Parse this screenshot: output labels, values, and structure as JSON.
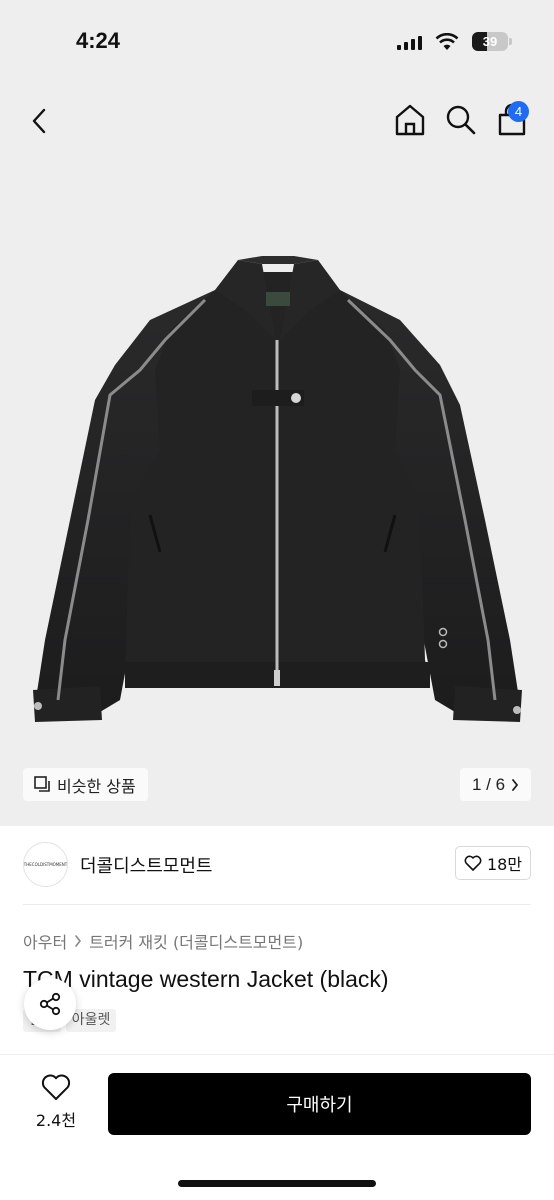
{
  "status_bar": {
    "time": "4:24",
    "battery": "39"
  },
  "nav": {
    "cart_count": "4",
    "icons": [
      "back-icon",
      "home-icon",
      "search-icon",
      "bag-icon"
    ]
  },
  "gallery": {
    "similar_label": "비슷한 상품",
    "counter": "1 / 6"
  },
  "shop": {
    "logo_text": "THECOLDISTMOMENT",
    "name": "더콜디스트모먼트",
    "likes": "18만"
  },
  "product": {
    "breadcrumb": [
      "아우터",
      "트러커 재킷 (더콜디스트모먼트)"
    ],
    "title": "TCM vintage western Jacket (black)",
    "tags": [
      "단독",
      "아울렛"
    ]
  },
  "actions": {
    "wish_count": "2.4천",
    "buy_label": "구매하기"
  },
  "colors": {
    "accent": "#1f6cf3",
    "buy_button": "#000000",
    "hero_bg": "#eeeeef"
  }
}
